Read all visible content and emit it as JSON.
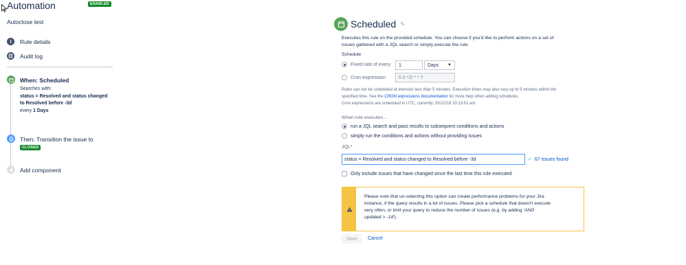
{
  "header": {
    "title": "Automation",
    "status_badge": "ENABLED"
  },
  "rule_name": "Autoclose test",
  "nav": {
    "rule_details": "Rule details",
    "audit_log": "Audit log"
  },
  "steps": {
    "trigger": {
      "title": "When: Scheduled",
      "searches_with": "Searches with:",
      "jql_prefix": "status = Resolved and status changed",
      "jql_suffix": "to Resolved before -3d",
      "every_label": "every",
      "every_value": "1 Days"
    },
    "action": {
      "title": "Then: Transition the issue to",
      "status_badge": "CLOSED"
    },
    "add_component": "Add component"
  },
  "panel": {
    "title": "Scheduled",
    "description_line1": "Executes this rule on the provided schedule. You can choose if you'd like to perform actions on a set of",
    "description_line2": "issues gathered with a JQL search or simply execute the rule.",
    "schedule_label": "Schedule",
    "fixed_rate_label": "Fixed rate of every",
    "fixed_rate_value": "1",
    "unit_selected": "Days",
    "cron_label": "Cron expression",
    "cron_placeholder": "0 0 */2 * * ?",
    "help_line1": "Rules can not be scheduled at intervals less than 5 minutes. Execution times may also vary up to 5 minutes within the",
    "help_line2_prefix": "specified time. See the",
    "help_line2_link": "CRON expressions documentation",
    "help_line2_suffix": "for more help when adding schedules.",
    "utc_note": "Cron expressions are scheduled in UTC, currently: 05/12/18 10:13:01 am",
    "when_executes_label": "When rule executes...",
    "option_jql": "run a JQL search and pass results to subsequent conditions and actions",
    "option_simple": "simply run the conditions and actions without providing issues",
    "jql_label": "JQL",
    "jql_required_mark": "*",
    "jql_value": "status = Resolved and status changed to Resolved before -3d",
    "issues_found": "67 issues found",
    "only_changed_label": "Only include issues that have changed since the last time this rule executed",
    "warning_line1": "Please note that un-selecting this option can create performance problems for your Jira",
    "warning_line2": "instance, if the query results in a lot of issues. Please pick a schedule that doesn't execute",
    "warning_line3_prefix": "very often, or limit your query to reduce the number of issues (e.g. by adding '",
    "warning_line3_em": "AND",
    "warning_line4_em": "updated > -1d",
    "warning_line4_suffix": "').",
    "save_label": "Save",
    "cancel_label": "Cancel"
  },
  "colors": {
    "green": "#57a55a",
    "badge_green": "#14892c",
    "warning_yellow": "#f6c342",
    "link_blue": "#0052cc",
    "nav_icon": "#42526e"
  }
}
